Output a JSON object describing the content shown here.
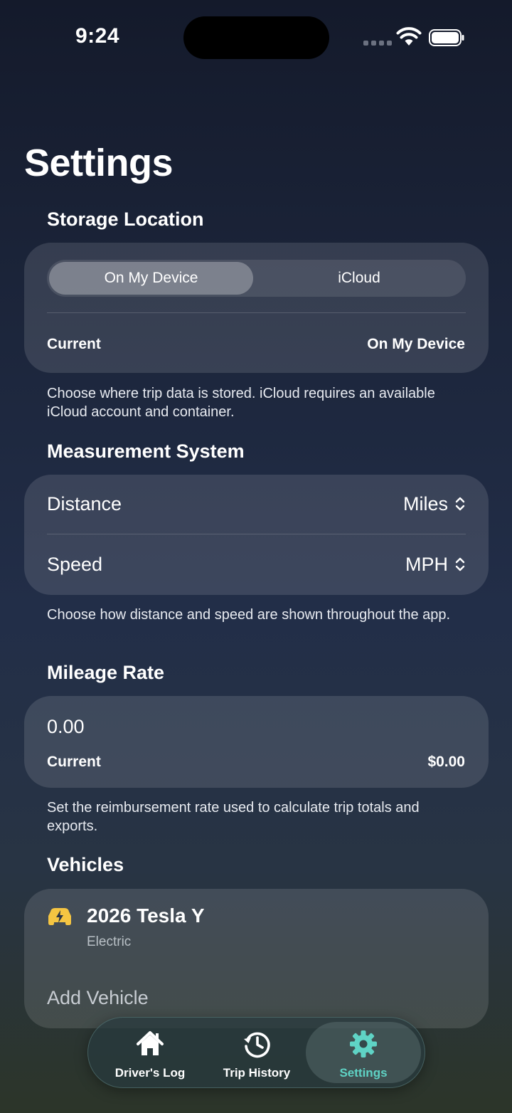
{
  "status_bar": {
    "time": "9:24"
  },
  "page": {
    "title": "Settings"
  },
  "storage": {
    "header": "Storage Location",
    "options": [
      "On My Device",
      "iCloud"
    ],
    "selected_index": 0,
    "current_label": "Current",
    "current_value": "On My Device",
    "footnote": "Choose where trip data is stored. iCloud requires an available iCloud account and container."
  },
  "measurement": {
    "header": "Measurement System",
    "distance_label": "Distance",
    "distance_value": "Miles",
    "speed_label": "Speed",
    "speed_value": "MPH",
    "footnote": "Choose how distance and speed are shown throughout the app."
  },
  "mileage": {
    "header": "Mileage Rate",
    "input_value": "0.00",
    "current_label": "Current",
    "current_value": "$0.00",
    "footnote": "Set the reimbursement rate used to calculate trip totals and exports."
  },
  "vehicles": {
    "header": "Vehicles",
    "items": [
      {
        "name": "2026 Tesla Y",
        "type": "Electric",
        "icon": "electric-car-icon",
        "icon_color": "#f5c542"
      }
    ],
    "add_label": "Add Vehicle"
  },
  "tab_bar": {
    "tabs": [
      {
        "label": "Driver's Log",
        "icon": "house-icon"
      },
      {
        "label": "Trip History",
        "icon": "clock-history-icon"
      },
      {
        "label": "Settings",
        "icon": "gear-icon"
      }
    ],
    "active_index": 2,
    "active_color": "#5fd3c5"
  }
}
